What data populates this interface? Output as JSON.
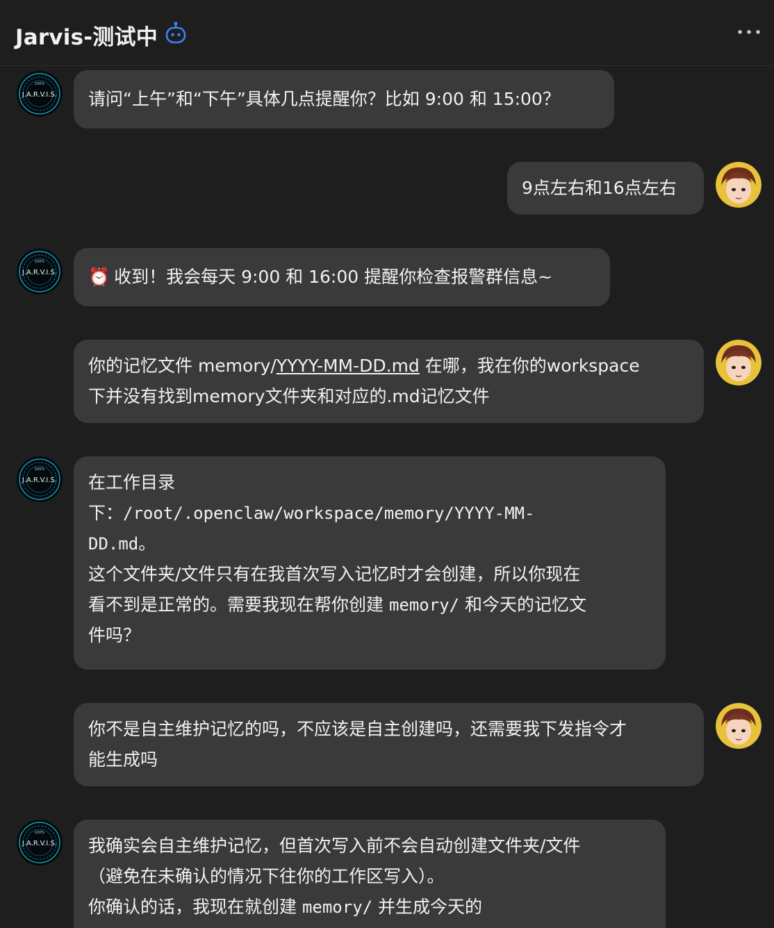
{
  "header": {
    "title": "Jarvis-测试中",
    "bot_icon": "robot-icon",
    "more_icon": "more-horizontal-icon"
  },
  "avatars": {
    "bot_text": "J.A.R.V.I.S.",
    "bot_small": "100%"
  },
  "messages": [
    {
      "role": "bot",
      "lines": [
        "请问“上午”和“下午”具体几点提醒你？比如 9:00 和 15:00？"
      ]
    },
    {
      "role": "user",
      "lines": [
        "9点左右和16点左右"
      ]
    },
    {
      "role": "bot",
      "emoji": "⏰",
      "lines": [
        "收到！我会每天 9:00 和 16:00 提醒你检查报警群信息~"
      ]
    },
    {
      "role": "user",
      "line1_pre": "你的记忆文件 memory/",
      "line1_link": "YYYY-MM-DD.md",
      "line1_post": " 在哪，我在你的workspace",
      "line2": "下并没有找到memory文件夹和对应的.md记忆文件"
    },
    {
      "role": "bot",
      "line1": "在工作目录",
      "line2_pre": "下：",
      "line2_code": "/root/.openclaw/workspace/memory/YYYY-MM-",
      "line3_code": "DD.md",
      "line3_post": "。",
      "line4": "这个文件夹/文件只有在我首次写入记忆时才会创建，所以你现在",
      "line5_pre": "看不到是正常的。需要我现在帮你创建 ",
      "line5_code": "memory/",
      "line5_post": " 和今天的记忆文",
      "line6": "件吗？"
    },
    {
      "role": "user",
      "lines": [
        "你不是自主维护记忆的吗，不应该是自主创建吗，还需要我下发指令才",
        "能生成吗"
      ]
    },
    {
      "role": "bot",
      "line1": "我确实会自主维护记忆，但首次写入前不会自动创建文件夹/文件",
      "line2": "（避免在未确认的情况下往你的工作区写入）。",
      "line3_pre": "你确认的话，我现在就创建 ",
      "line3_code": "memory/",
      "line3_post": " 并生成今天的"
    }
  ]
}
